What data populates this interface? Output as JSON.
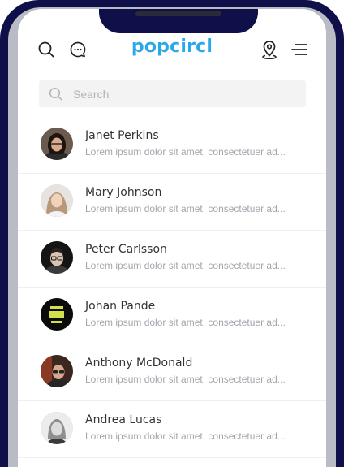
{
  "app": {
    "logo": "popcircl"
  },
  "header": {
    "left_icons": [
      "search-icon",
      "chat-bubble-icon"
    ],
    "right_icons": [
      "location-pin-icon",
      "menu-icon"
    ]
  },
  "search": {
    "placeholder": "Search"
  },
  "colors": {
    "brand": "#2aa8e8",
    "phone_frame": "#0f0f4a",
    "name_text": "#333333",
    "snippet_text": "#a4a6ad"
  },
  "contacts": [
    {
      "name": "Janet Perkins",
      "snippet": "Lorem ipsum dolor sit amet, consectetuer ad..."
    },
    {
      "name": "Mary Johnson",
      "snippet": "Lorem ipsum dolor sit amet, consectetuer ad..."
    },
    {
      "name": "Peter Carlsson",
      "snippet": "Lorem ipsum dolor sit amet, consectetuer ad..."
    },
    {
      "name": "Johan Pande",
      "snippet": "Lorem ipsum dolor sit amet, consectetuer ad..."
    },
    {
      "name": "Anthony McDonald",
      "snippet": "Lorem ipsum dolor sit amet, consectetuer ad..."
    },
    {
      "name": "Andrea Lucas",
      "snippet": "Lorem ipsum dolor sit amet, consectetuer ad..."
    }
  ]
}
